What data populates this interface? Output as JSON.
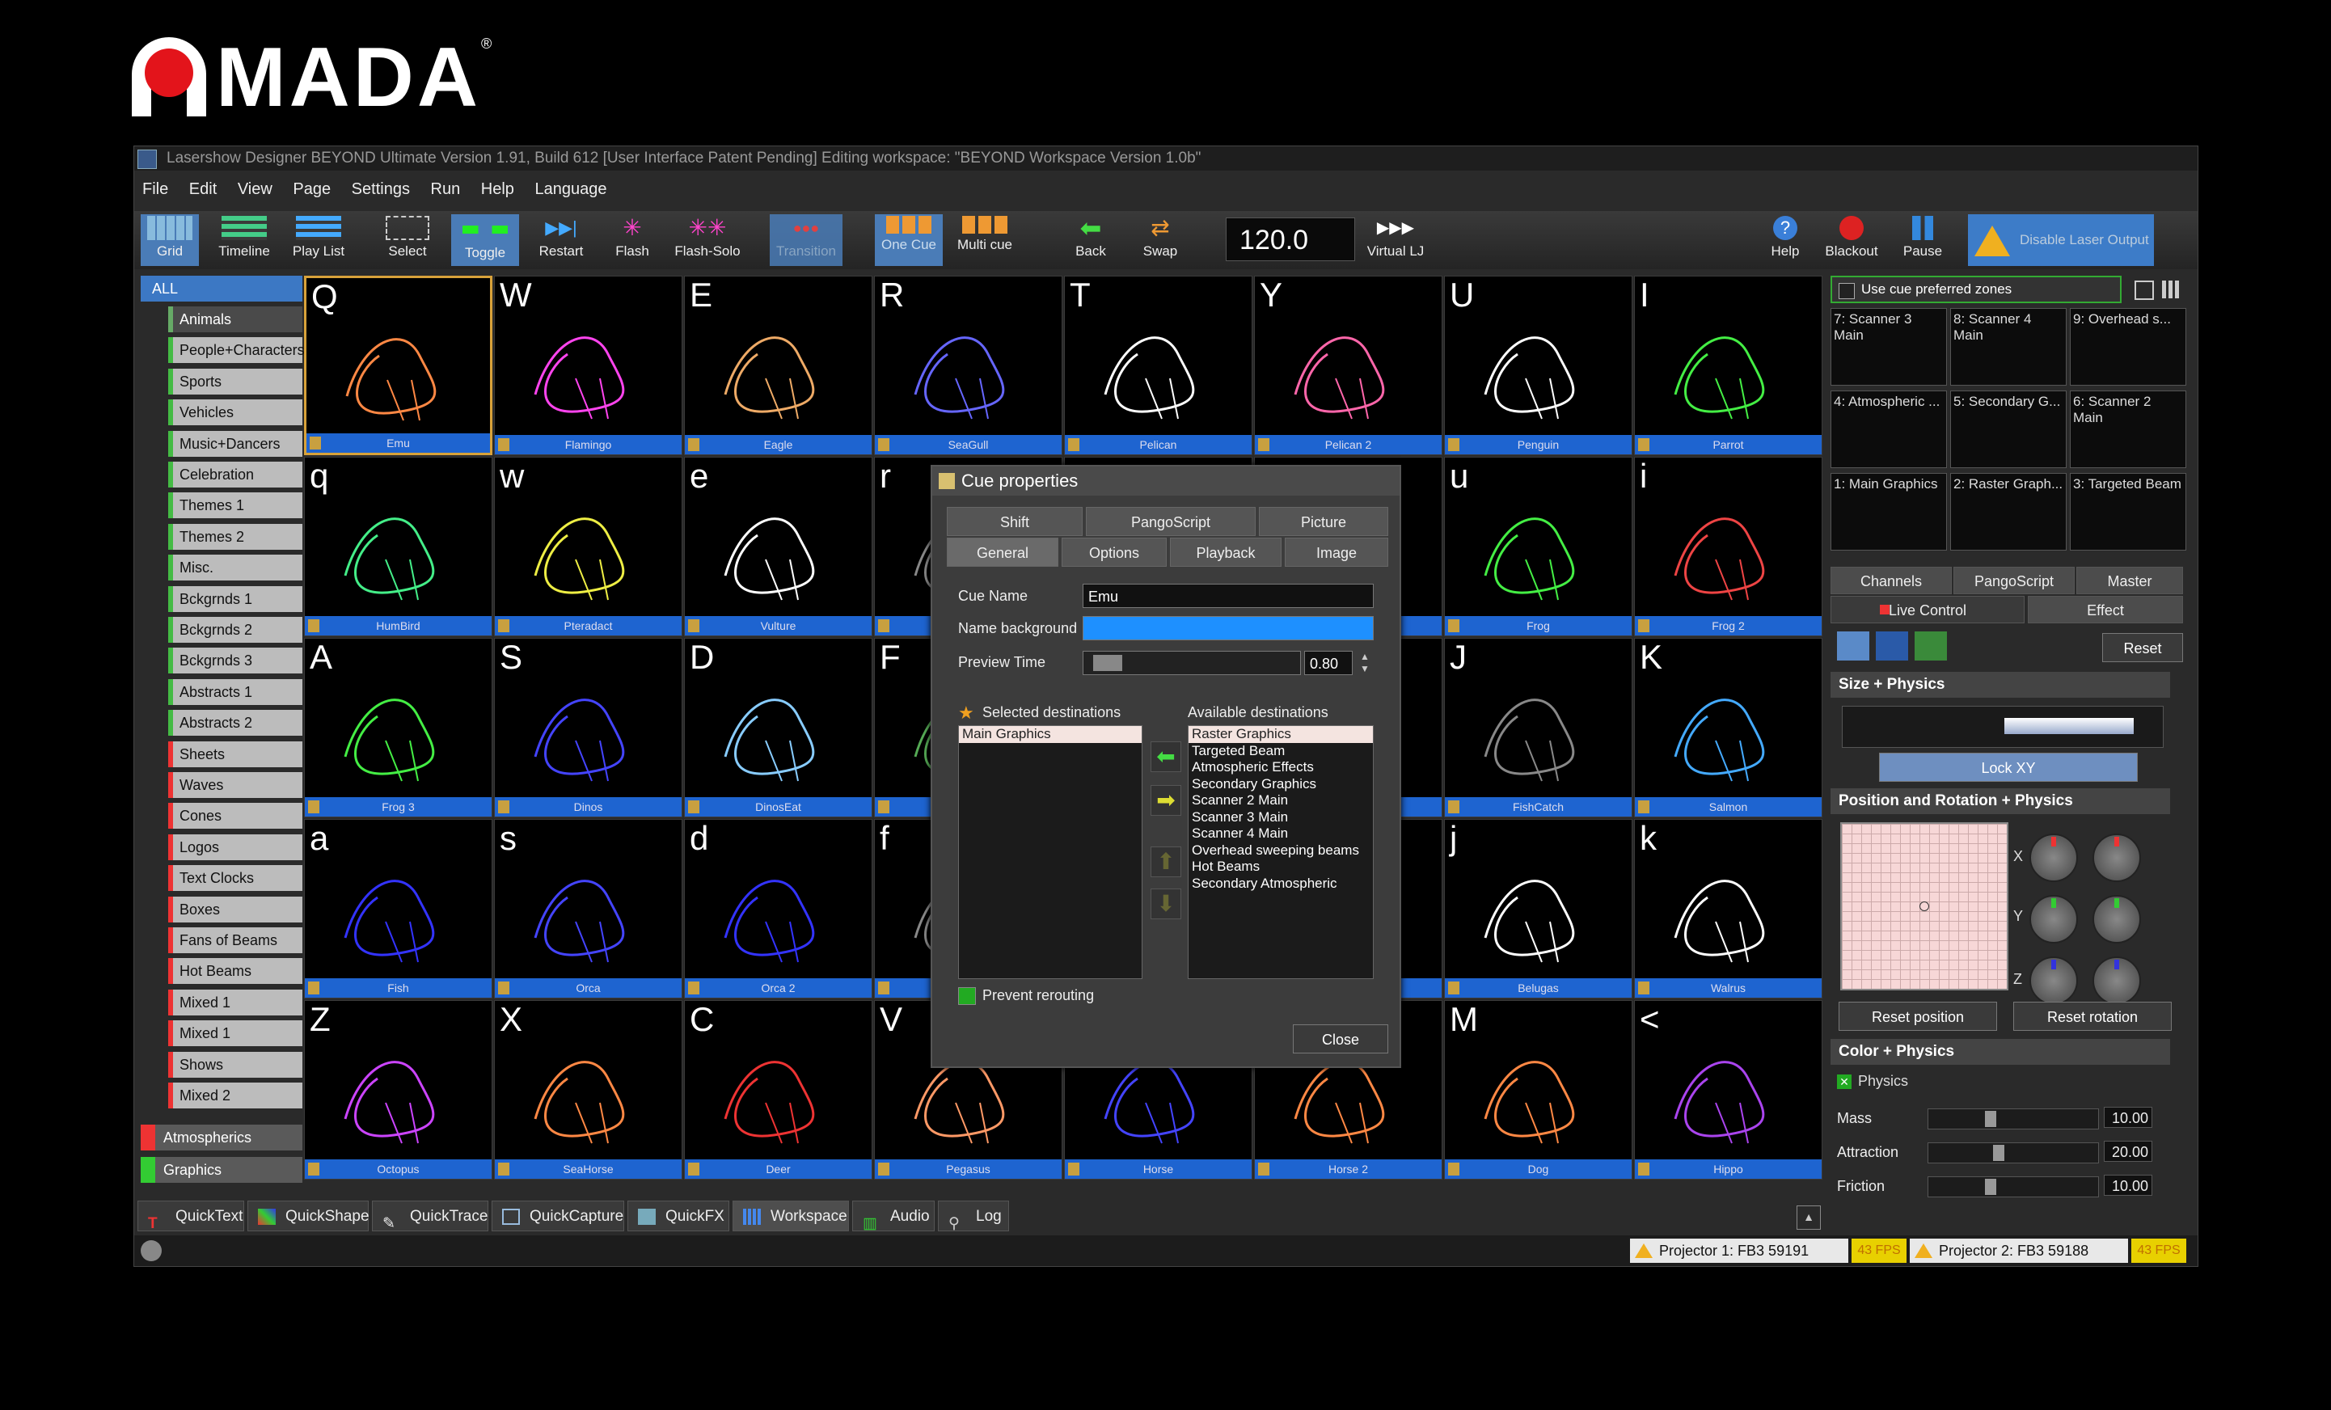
{
  "logo": {
    "text": "MADA",
    "reg": "®"
  },
  "window": {
    "title": "Lasershow Designer BEYOND Ultimate   Version 1.91, Build 612   [User Interface Patent Pending]   Editing workspace: \"BEYOND Workspace Version 1.0b\""
  },
  "menu": [
    "File",
    "Edit",
    "View",
    "Page",
    "Settings",
    "Run",
    "Help",
    "Language"
  ],
  "toolbar": {
    "grid": "Grid",
    "timeline": "Timeline",
    "playlist": "Play List",
    "select": "Select",
    "toggle": "Toggle",
    "restart": "Restart",
    "flash": "Flash",
    "flashsolo": "Flash-Solo",
    "transition": "Transition",
    "onecue": "One Cue",
    "multicue": "Multi cue",
    "back": "Back",
    "swap": "Swap",
    "bpm": "120.0",
    "virtuallj": "Virtual LJ",
    "help": "Help",
    "blackout": "Blackout",
    "pause": "Pause",
    "disable": "Disable Laser Output"
  },
  "sidebar": {
    "all": "ALL",
    "items": [
      "Animals",
      "People+Characters",
      "Sports",
      "Vehicles",
      "Music+Dancers",
      "Celebration",
      "Themes 1",
      "Themes 2",
      "Misc.",
      "Bckgrnds 1",
      "Bckgrnds 2",
      "Bckgrnds 3",
      "Abstracts 1",
      "Abstracts 2",
      "Sheets",
      "Waves",
      "Cones",
      "Logos",
      "Text  Clocks",
      "Boxes",
      "Fans of Beams",
      "Hot Beams",
      "Mixed 1",
      "Mixed 1",
      "Shows",
      "Mixed 2"
    ],
    "atmospherics": "Atmospherics",
    "graphics": "Graphics"
  },
  "grid": [
    [
      {
        "k": "Q",
        "n": "Emu"
      },
      {
        "k": "W",
        "n": "Flamingo"
      },
      {
        "k": "E",
        "n": "Eagle"
      },
      {
        "k": "R",
        "n": "SeaGull"
      },
      {
        "k": "T",
        "n": "Pelican"
      },
      {
        "k": "Y",
        "n": "Pelican 2"
      },
      {
        "k": "U",
        "n": "Penguin"
      },
      {
        "k": "I",
        "n": "Parrot"
      }
    ],
    [
      {
        "k": "q",
        "n": "HumBird"
      },
      {
        "k": "w",
        "n": "Pteradact"
      },
      {
        "k": "e",
        "n": "Vulture"
      },
      {
        "k": "r",
        "n": ""
      },
      {
        "k": "",
        "n": ""
      },
      {
        "k": "",
        "n": ""
      },
      {
        "k": "u",
        "n": "Frog"
      },
      {
        "k": "i",
        "n": "Frog 2"
      }
    ],
    [
      {
        "k": "A",
        "n": "Frog 3"
      },
      {
        "k": "S",
        "n": "Dinos"
      },
      {
        "k": "D",
        "n": "DinosEat"
      },
      {
        "k": "F",
        "n": ""
      },
      {
        "k": "",
        "n": ""
      },
      {
        "k": "",
        "n": ""
      },
      {
        "k": "J",
        "n": "FishCatch"
      },
      {
        "k": "K",
        "n": "Salmon"
      }
    ],
    [
      {
        "k": "a",
        "n": "Fish"
      },
      {
        "k": "s",
        "n": "Orca"
      },
      {
        "k": "d",
        "n": "Orca 2"
      },
      {
        "k": "f",
        "n": ""
      },
      {
        "k": "",
        "n": ""
      },
      {
        "k": "",
        "n": ""
      },
      {
        "k": "j",
        "n": "Belugas"
      },
      {
        "k": "k",
        "n": "Walrus"
      }
    ],
    [
      {
        "k": "Z",
        "n": "Octopus"
      },
      {
        "k": "X",
        "n": "SeaHorse"
      },
      {
        "k": "C",
        "n": "Deer"
      },
      {
        "k": "V",
        "n": "Pegasus"
      },
      {
        "k": "",
        "n": "Horse"
      },
      {
        "k": "",
        "n": "Horse 2"
      },
      {
        "k": "M",
        "n": "Dog"
      },
      {
        "k": "<",
        "n": "Hippo"
      }
    ]
  ],
  "dialog": {
    "title": "Cue properties",
    "tabs_row1": [
      "Shift",
      "PangoScript",
      "Picture"
    ],
    "tabs_row2": [
      "General",
      "Options",
      "Playback",
      "Image"
    ],
    "cue_name_label": "Cue Name",
    "cue_name": "Emu",
    "name_bg_label": "Name background",
    "preview_label": "Preview Time",
    "preview_value": "0.80",
    "selected_label": "Selected destinations",
    "selected": [
      "Main Graphics"
    ],
    "available_label": "Available destinations",
    "available": [
      "Raster Graphics",
      "Targeted Beam",
      "Atmospheric Effects",
      "Secondary Graphics",
      "Scanner 2 Main",
      "Scanner 3 Main",
      "Scanner 4 Main",
      "Overhead sweeping beams",
      "Hot Beams",
      "Secondary Atmospheric"
    ],
    "prevent": "Prevent rerouting",
    "close": "Close"
  },
  "right": {
    "use_zones": "Use cue preferred zones",
    "zones": [
      "7: Scanner 3 Main",
      "8: Scanner 4 Main",
      "9: Overhead s...",
      "4: Atmospheric ...",
      "5: Secondary G...",
      "6: Scanner 2 Main",
      "1: Main Graphics",
      "2: Raster Graph...",
      "3: Targeted Beam"
    ],
    "tabs": [
      "Channels",
      "PangoScript",
      "Master"
    ],
    "live": "Live Control",
    "effect": "Effect",
    "reset": "Reset",
    "size": "Size + Physics",
    "lockxy": "Lock XY",
    "posrot": "Position and Rotation + Physics",
    "x": "X",
    "y": "Y",
    "z": "Z",
    "reset_pos": "Reset position",
    "reset_rot": "Reset rotation",
    "color": "Color + Physics",
    "physics": "Physics",
    "mass": "Mass",
    "mass_v": "10.00",
    "attraction": "Attraction",
    "attraction_v": "20.00",
    "friction": "Friction",
    "friction_v": "10.00"
  },
  "bottom_tabs": [
    "QuickText",
    "QuickShape",
    "QuickTrace",
    "QuickCapture",
    "QuickFX",
    "Workspace",
    "Audio",
    "Log"
  ],
  "status": {
    "p1": "Projector 1: FB3 59191",
    "p1fps": "43 FPS",
    "p2": "Projector 2: FB3 59188",
    "p2fps": "43 FPS"
  }
}
